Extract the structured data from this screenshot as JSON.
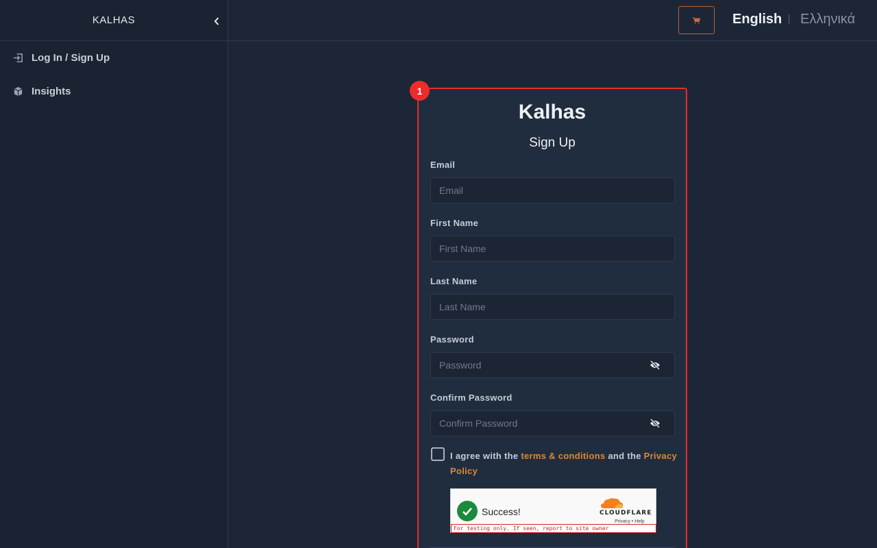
{
  "sidebar": {
    "brand": "KALHAS",
    "items": [
      {
        "label": "Log In / Sign Up",
        "icon": "login-icon"
      },
      {
        "label": "Insights",
        "icon": "insights-icon"
      }
    ]
  },
  "topbar": {
    "cart_icon": "cart-icon",
    "languages": [
      "English",
      "Ελληνικά"
    ],
    "active_language": "English"
  },
  "annotation": {
    "marker": "1"
  },
  "form": {
    "title": "Kalhas",
    "subtitle": "Sign Up",
    "fields": {
      "email": {
        "label": "Email",
        "placeholder": "Email"
      },
      "first_name": {
        "label": "First Name",
        "placeholder": "First Name"
      },
      "last_name": {
        "label": "Last Name",
        "placeholder": "Last Name"
      },
      "password": {
        "label": "Password",
        "placeholder": "Password"
      },
      "confirm_password": {
        "label": "Confirm Password",
        "placeholder": "Confirm Password"
      }
    },
    "agree": {
      "prefix": "I agree with the ",
      "terms_link": "terms & conditions",
      "middle": " and the ",
      "privacy_link": "Privacy Policy"
    },
    "captcha": {
      "status": "Success!",
      "provider": "CLOUDFLARE",
      "links": "Privacy • Help",
      "warning": "For testing only. If seen, report to site owner"
    }
  },
  "colors": {
    "accent": "#d4893c",
    "highlight": "#ee2b2b",
    "background": "#1c2636",
    "card": "#202d3f"
  }
}
